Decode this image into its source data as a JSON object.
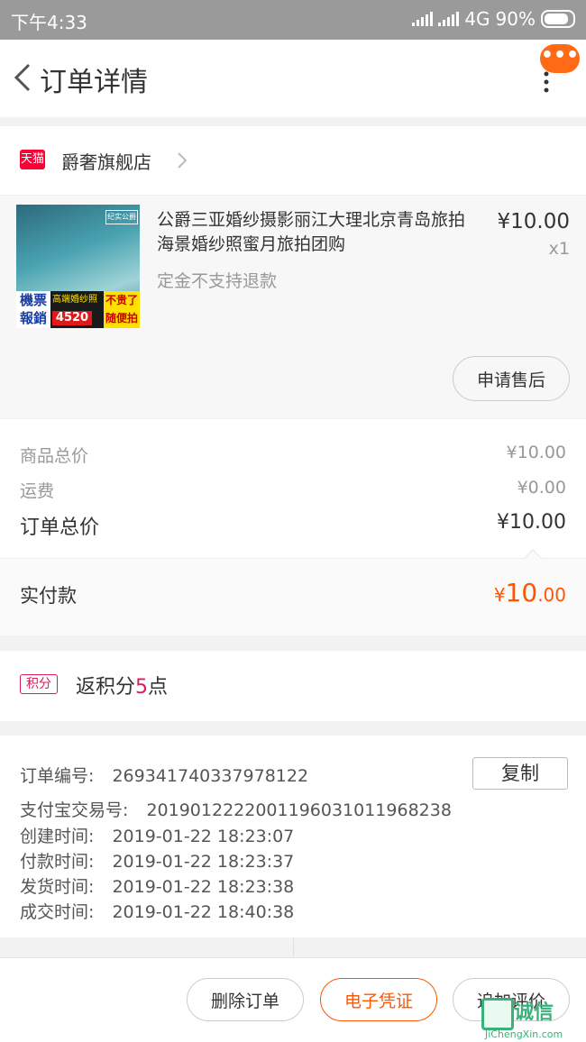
{
  "status_bar": {
    "time": "下午4:33",
    "network": "4G",
    "battery": "90%"
  },
  "header": {
    "title": "订单详情",
    "more_badge": "•••"
  },
  "shop": {
    "name": "爵奢旗舰店",
    "badge": "天猫"
  },
  "item": {
    "title": "公爵三亚婚纱摄影丽江大理北京青岛旅拍海景婚纱照蜜月旅拍团购",
    "price": "¥10.00",
    "quantity": "x1",
    "note": "定金不支持退款",
    "thumbnail_text": {
      "tag": "纪实公爵",
      "ticket": "機票報銷",
      "headline": "高端婚纱照",
      "price_tag": "4520",
      "slogan": "不贵了随便拍"
    },
    "after_sale_label": "申请售后"
  },
  "summary": {
    "goods_total_label": "商品总价",
    "goods_total_value": "¥10.00",
    "shipping_label": "运费",
    "shipping_value": "¥0.00",
    "order_total_label": "订单总价",
    "order_total_value": "¥10.00",
    "paid_label": "实付款",
    "paid_symbol": "¥",
    "paid_int": "10",
    "paid_dec": ".00"
  },
  "points": {
    "badge": "积分",
    "text_prefix": "返积分",
    "value": "5",
    "text_suffix": "点"
  },
  "order_info": {
    "order_no_label": "订单编号:",
    "order_no": "269341740337978122",
    "copy_label": "复制",
    "alipay_label": "支付宝交易号:",
    "alipay_no": "2019012222001196031011968238",
    "created_label": "创建时间:",
    "created": "2019-01-22 18:23:07",
    "paid_time_label": "付款时间:",
    "paid_time": "2019-01-22 18:23:37",
    "shipped_label": "发货时间:",
    "shipped": "2019-01-22 18:23:38",
    "completed_label": "成交时间:",
    "completed": "2019-01-22 18:40:38"
  },
  "bottom_bar": {
    "delete_label": "删除订单",
    "voucher_label": "电子凭证",
    "review_label": "追加评价"
  },
  "watermark": {
    "text": "诚信",
    "sub": "JiChengXin.com"
  },
  "colors": {
    "accent": "#ff5500",
    "points": "#d81e54",
    "tmall": "#ff0036"
  }
}
